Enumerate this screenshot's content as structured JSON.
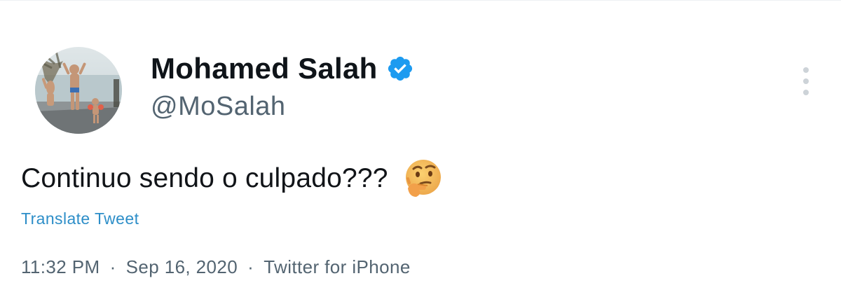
{
  "tweet": {
    "author": {
      "display_name": "Mohamed Salah",
      "handle": "@MoSalah",
      "verified": true,
      "avatar_icon": "profile-photo-beach"
    },
    "text": "Continuo sendo o culpado???",
    "emoji": "thinking-face",
    "translate_label": "Translate Tweet",
    "time": "11:32 PM",
    "separator": "·",
    "date": "Sep 16, 2020",
    "source": "Twitter for iPhone",
    "more_icon": "vertical-ellipsis-icon"
  },
  "colors": {
    "text_primary": "#0f1419",
    "text_secondary": "#536471",
    "link": "#2d8ec8",
    "verified_blue": "#1d9bf0",
    "more_dots": "#cdd3d8"
  }
}
